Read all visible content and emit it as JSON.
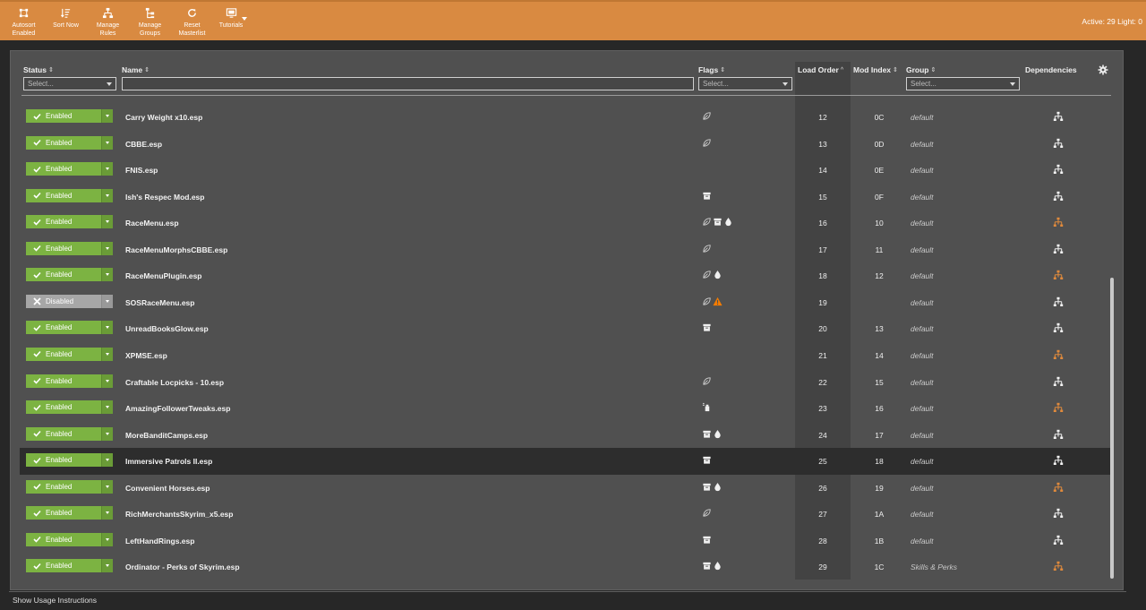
{
  "toolbar": {
    "buttons": [
      {
        "label": "Autosort\nEnabled",
        "icon": "autosort-icon"
      },
      {
        "label": "Sort Now",
        "icon": "sort-list-icon"
      },
      {
        "label": "Manage\nRules",
        "icon": "rules-tree-icon"
      },
      {
        "label": "Manage\nGroups",
        "icon": "groups-icon"
      },
      {
        "label": "Reset\nMasterlist",
        "icon": "refresh-icon"
      },
      {
        "label": "Tutorials",
        "icon": "tutorial-screen-icon"
      }
    ],
    "active_count": "Active: 29 Light: 0",
    "accent": "#d98a41"
  },
  "header": {
    "status": "Status",
    "name": "Name",
    "flags": "Flags",
    "load_order": "Load Order",
    "mod_index": "Mod Index",
    "group": "Group",
    "dependencies": "Dependencies",
    "status_select": "Select...",
    "flags_select": "Select...",
    "group_select": "Select..."
  },
  "status_labels": {
    "enabled": "Enabled",
    "disabled": "Disabled"
  },
  "rows": [
    {
      "status": "enabled",
      "name": "Carry Weight x10.esp",
      "flags": [
        "leaf-icon"
      ],
      "lo": "12",
      "mi": "0C",
      "group": "default",
      "dep": "white"
    },
    {
      "status": "enabled",
      "name": "CBBE.esp",
      "flags": [
        "leaf-icon"
      ],
      "lo": "13",
      "mi": "0D",
      "group": "default",
      "dep": "white"
    },
    {
      "status": "enabled",
      "name": "FNIS.esp",
      "flags": [],
      "lo": "14",
      "mi": "0E",
      "group": "default",
      "dep": "white"
    },
    {
      "status": "enabled",
      "name": "Ish's Respec Mod.esp",
      "flags": [
        "archive-icon"
      ],
      "lo": "15",
      "mi": "0F",
      "group": "default",
      "dep": "white"
    },
    {
      "status": "enabled",
      "name": "RaceMenu.esp",
      "flags": [
        "leaf-icon",
        "archive-icon",
        "drop-icon"
      ],
      "lo": "16",
      "mi": "10",
      "group": "default",
      "dep": "orange"
    },
    {
      "status": "enabled",
      "name": "RaceMenuMorphsCBBE.esp",
      "flags": [
        "leaf-icon"
      ],
      "lo": "17",
      "mi": "11",
      "group": "default",
      "dep": "white"
    },
    {
      "status": "enabled",
      "name": "RaceMenuPlugin.esp",
      "flags": [
        "leaf-icon",
        "drop-icon"
      ],
      "lo": "18",
      "mi": "12",
      "group": "default",
      "dep": "orange"
    },
    {
      "status": "disabled",
      "name": "SOSRaceMenu.esp",
      "flags": [
        "leaf-icon",
        "warning-icon"
      ],
      "lo": "19",
      "mi": "",
      "group": "default",
      "dep": "white"
    },
    {
      "status": "enabled",
      "name": "UnreadBooksGlow.esp",
      "flags": [
        "archive-icon"
      ],
      "lo": "20",
      "mi": "13",
      "group": "default",
      "dep": "white"
    },
    {
      "status": "enabled",
      "name": "XPMSE.esp",
      "flags": [],
      "lo": "21",
      "mi": "14",
      "group": "default",
      "dep": "orange"
    },
    {
      "status": "enabled",
      "name": "Craftable Locpicks - 10.esp",
      "flags": [
        "leaf-icon"
      ],
      "lo": "22",
      "mi": "15",
      "group": "default",
      "dep": "white"
    },
    {
      "status": "enabled",
      "name": "AmazingFollowerTweaks.esp",
      "flags": [
        "spray-icon"
      ],
      "lo": "23",
      "mi": "16",
      "group": "default",
      "dep": "orange"
    },
    {
      "status": "enabled",
      "name": "MoreBanditCamps.esp",
      "flags": [
        "archive-icon",
        "drop-icon"
      ],
      "lo": "24",
      "mi": "17",
      "group": "default",
      "dep": "white"
    },
    {
      "status": "enabled",
      "name": "Immersive Patrols II.esp",
      "flags": [
        "archive-icon"
      ],
      "lo": "25",
      "mi": "18",
      "group": "default",
      "dep": "white",
      "highlight": true
    },
    {
      "status": "enabled",
      "name": "Convenient Horses.esp",
      "flags": [
        "archive-icon",
        "drop-icon"
      ],
      "lo": "26",
      "mi": "19",
      "group": "default",
      "dep": "orange"
    },
    {
      "status": "enabled",
      "name": "RichMerchantsSkyrim_x5.esp",
      "flags": [
        "leaf-icon"
      ],
      "lo": "27",
      "mi": "1A",
      "group": "default",
      "dep": "white"
    },
    {
      "status": "enabled",
      "name": "LeftHandRings.esp",
      "flags": [
        "archive-icon"
      ],
      "lo": "28",
      "mi": "1B",
      "group": "default",
      "dep": "white"
    },
    {
      "status": "enabled",
      "name": "Ordinator - Perks of Skyrim.esp",
      "flags": [
        "archive-icon",
        "drop-icon"
      ],
      "lo": "29",
      "mi": "1C",
      "group": "Skills & Perks",
      "dep": "orange"
    }
  ],
  "footer": {
    "label": "Show Usage Instructions"
  },
  "colors": {
    "enabled": "#7cb342",
    "disabled": "#a7a7a7",
    "warning": "#f57c00",
    "dep_orange": "#e08a3c"
  }
}
